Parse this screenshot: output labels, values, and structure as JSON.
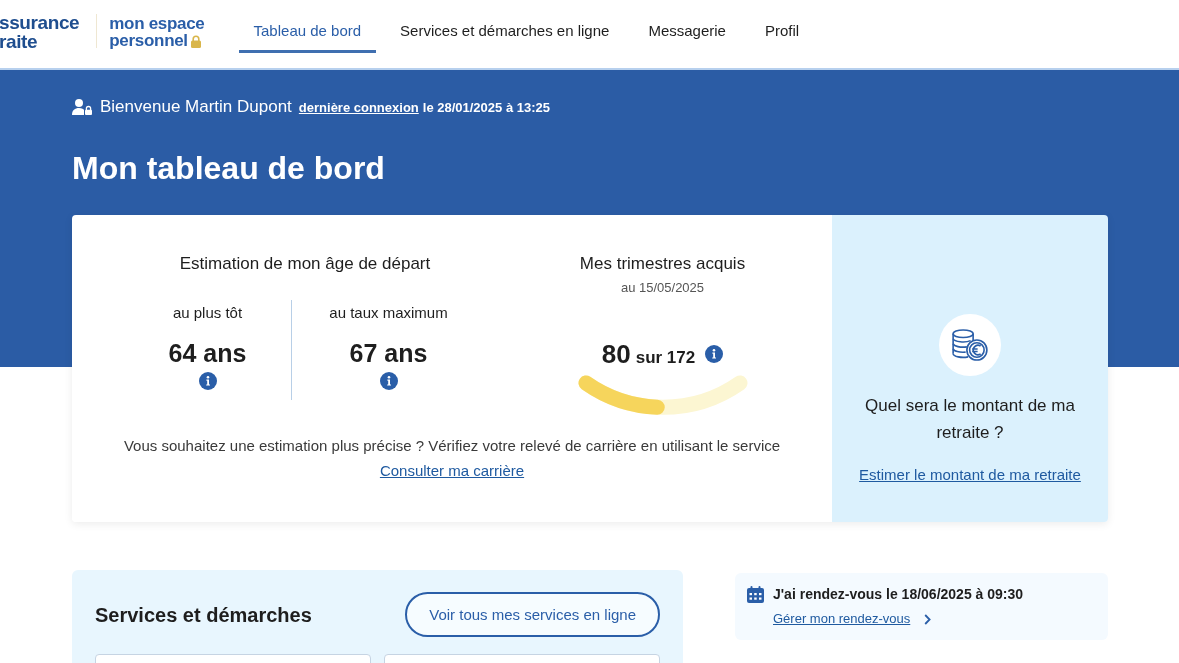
{
  "header": {
    "logo": {
      "line_1": "ssurance",
      "line_2": "raite"
    },
    "space_title": {
      "line_1": "mon espace",
      "line_2": "personnel"
    },
    "tabs": [
      {
        "label": "Tableau de bord",
        "selected": true
      },
      {
        "label": "Services et démarches en ligne",
        "selected": false
      },
      {
        "label": "Messagerie",
        "selected": false
      },
      {
        "label": "Profil",
        "selected": false
      }
    ]
  },
  "welcome": {
    "greeting": "Bienvenue Martin Dupont",
    "last_login_link": "dernière connexion",
    "last_login": "le 28/01/2025 à 13:25"
  },
  "page_title": "Mon tableau de bord",
  "departure_age": {
    "title": "Estimation de mon âge de départ",
    "options": [
      {
        "label": "au plus tôt",
        "value": "64 ans"
      },
      {
        "label": "au taux maximum",
        "value": "67 ans"
      }
    ]
  },
  "quarters": {
    "title": "Mes trimestres acquis",
    "date": "au 15/05/2025",
    "value": "80",
    "total": "sur 172",
    "level": 0.465
  },
  "precision": {
    "text": "Vous souhaitez une estimation plus précise ? Vérifiez votre relevé de carrière en utilisant le service",
    "link": "Consulter ma carrière"
  },
  "pension_panel": {
    "question": "Quel sera le montant de ma retraite ?",
    "link": "Estimer le montant de ma retraite"
  },
  "services": {
    "title": "Services et démarches",
    "button": "Voir tous mes services en ligne"
  },
  "appointment": {
    "text": "J'ai rendez-vous le 18/06/2025 à 09:30",
    "link": "Gérer mon rendez-vous"
  }
}
